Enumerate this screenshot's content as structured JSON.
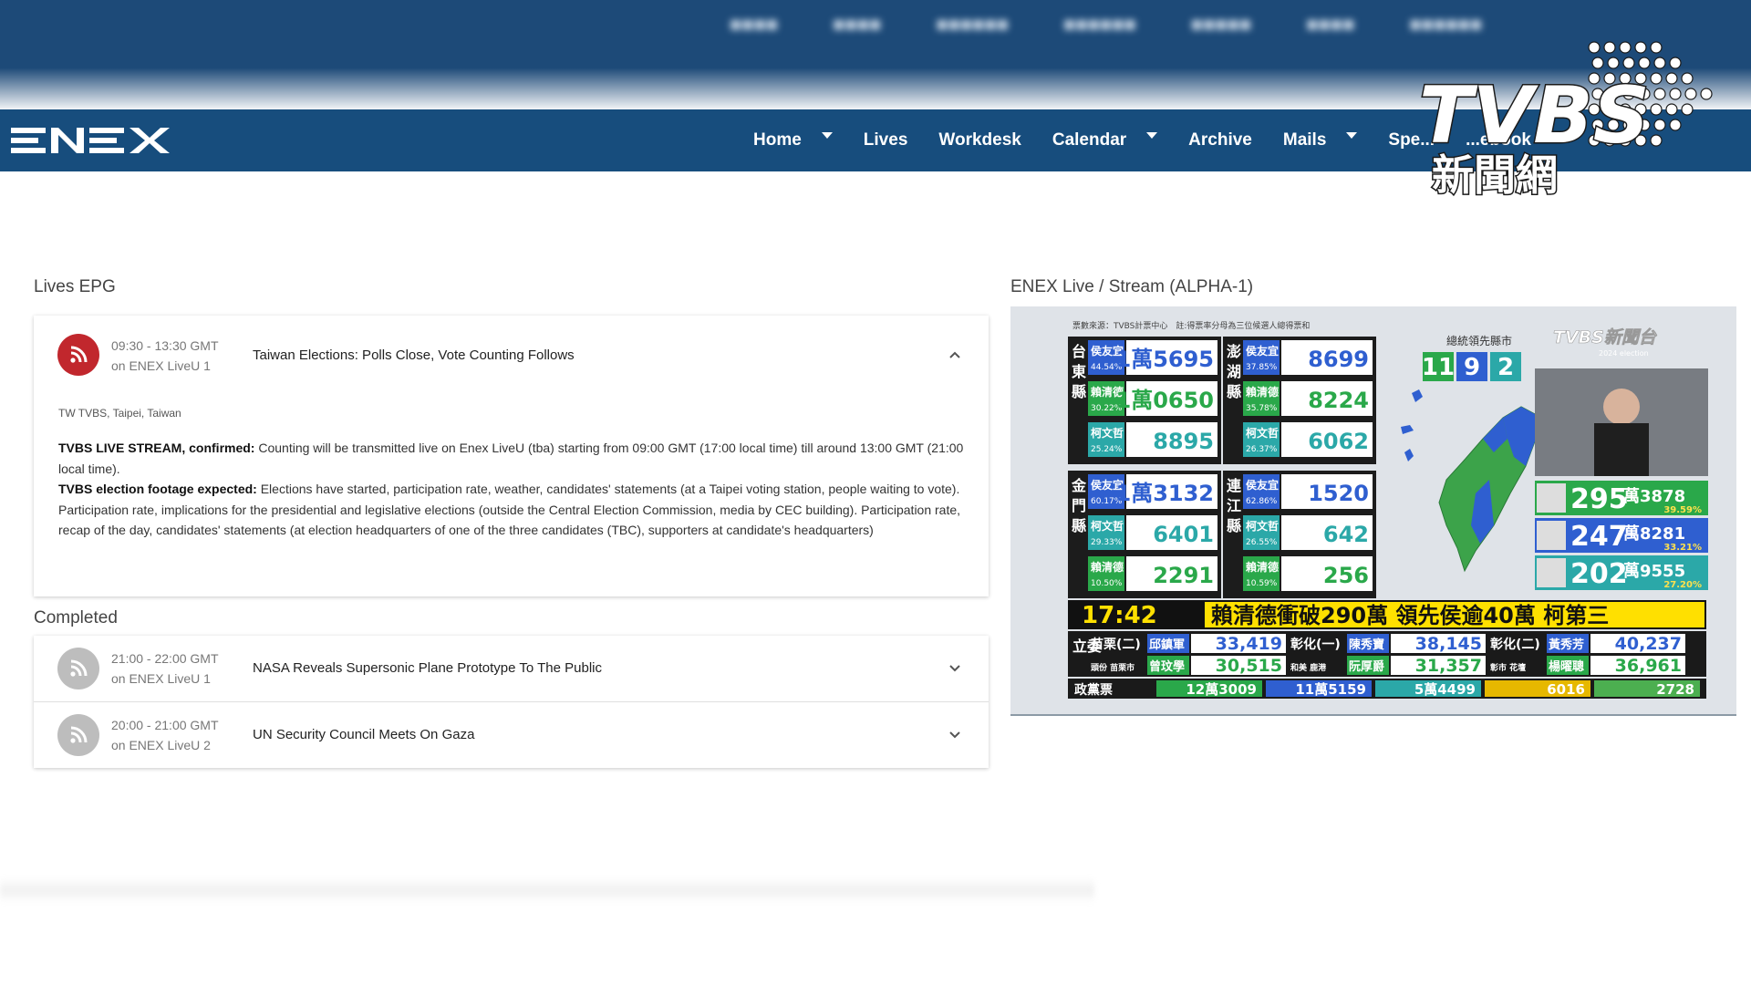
{
  "navbar": {
    "brand": "ENEX",
    "items": [
      {
        "label": "Home",
        "dropdown": true
      },
      {
        "label": "Lives",
        "dropdown": false
      },
      {
        "label": "Workdesk",
        "dropdown": false
      },
      {
        "label": "Calendar",
        "dropdown": true
      },
      {
        "label": "Archive",
        "dropdown": false
      },
      {
        "label": "Mails",
        "dropdown": true
      },
      {
        "label": "Spe...",
        "dropdown": false
      },
      {
        "label": "...ebook",
        "dropdown": false
      }
    ]
  },
  "watermark": {
    "brand": "TVBS",
    "subtitle": "新聞網"
  },
  "lives_epg": {
    "title": "Lives EPG",
    "active": {
      "time": "09:30 - 13:30 GMT",
      "channel": "on ENEX LiveU 1",
      "title": "Taiwan Elections: Polls Close, Vote Counting Follows",
      "location": "TW TVBS, Taipei, Taiwan",
      "para1_bold": "TVBS LIVE STREAM, confirmed:",
      "para1_text": " Counting will be transmitted live on Enex LiveU (tba) starting from 09:00 GMT (17:00 local time) till around 13:00 GMT (21:00 local time).",
      "para2_bold": "TVBS election footage expected:",
      "para2_text": " Elections have started, participation rate, weather, candidates' statements (at a Taipei voting station, people waiting to vote). Participation rate, implications for the presidential and legislative elections (outside the Central Election Commission, media by CEC building). Participation rate, recap of the day, candidates' statements (at election headquarters of one of the three candidates (TBC), supporters at candidate's headquarters)"
    }
  },
  "completed": {
    "title": "Completed",
    "items": [
      {
        "time": "21:00 - 22:00 GMT",
        "channel": "on ENEX LiveU 1",
        "title": "NASA Reveals Supersonic Plane Prototype To The Public"
      },
      {
        "time": "20:00 - 21:00 GMT",
        "channel": "on ENEX LiveU 2",
        "title": "UN Security Council Meets On Gaza"
      }
    ]
  },
  "stream": {
    "title": "ENEX Live / Stream (ALPHA-1)",
    "source_note": "票數來源：TVBS計票中心　註:得票率分母為三位候選人總得票和",
    "channel_logo": "TVBS新聞台",
    "channel_sub": "2024 election",
    "leading_label": "總統領先縣市",
    "leading_counts": [
      "11",
      "9",
      "2"
    ],
    "leading_colors": [
      "#2aa84a",
      "#2f5fd0",
      "#2ba8a8"
    ],
    "counties": [
      {
        "name": "台東縣",
        "rows": [
          {
            "cand": "侯友宜",
            "pct": "44.54%",
            "votes": "1萬5695",
            "color": "#2f5fd0"
          },
          {
            "cand": "賴清德",
            "pct": "30.22%",
            "votes": "1萬0650",
            "color": "#2aa84a"
          },
          {
            "cand": "柯文哲",
            "pct": "25.24%",
            "votes": "8895",
            "color": "#2ba8a8"
          }
        ]
      },
      {
        "name": "澎湖縣",
        "rows": [
          {
            "cand": "侯友宜",
            "pct": "37.85%",
            "votes": "8699",
            "color": "#2f5fd0"
          },
          {
            "cand": "賴清德",
            "pct": "35.78%",
            "votes": "8224",
            "color": "#2aa84a"
          },
          {
            "cand": "柯文哲",
            "pct": "26.37%",
            "votes": "6062",
            "color": "#2ba8a8"
          }
        ]
      },
      {
        "name": "金門縣",
        "rows": [
          {
            "cand": "侯友宜",
            "pct": "60.17%",
            "votes": "1萬3132",
            "color": "#2f5fd0"
          },
          {
            "cand": "柯文哲",
            "pct": "29.33%",
            "votes": "6401",
            "color": "#2ba8a8"
          },
          {
            "cand": "賴清德",
            "pct": "10.50%",
            "votes": "2291",
            "color": "#2aa84a"
          }
        ]
      },
      {
        "name": "連江縣",
        "rows": [
          {
            "cand": "侯友宜",
            "pct": "62.86%",
            "votes": "1520",
            "color": "#2f5fd0"
          },
          {
            "cand": "柯文哲",
            "pct": "26.55%",
            "votes": "642",
            "color": "#2ba8a8"
          },
          {
            "cand": "賴清德",
            "pct": "10.59%",
            "votes": "256",
            "color": "#2aa84a"
          }
        ]
      }
    ],
    "totals": [
      {
        "votes": "295",
        "unit": "萬3878",
        "pct": "39.59%",
        "color": "#2aa84a"
      },
      {
        "votes": "247",
        "unit": "萬8281",
        "pct": "33.21%",
        "color": "#2f5fd0"
      },
      {
        "votes": "202",
        "unit": "萬9555",
        "pct": "27.20%",
        "color": "#2ba8a8"
      }
    ],
    "ticker_time": "17:42",
    "ticker_text": "賴清德衝破290萬 領先侯逾40萬 柯第三",
    "legis_label": "立委",
    "legis": [
      {
        "district": "苗栗(二)",
        "cand1": "邱鎮軍",
        "v1": "33,419",
        "district2": "彰化(一)",
        "cand2": "陳秀寶",
        "v2": "38,145",
        "district3": "彰化(二)",
        "cand3": "黃秀芳",
        "v3": "40,237"
      },
      {
        "district": "頭份 苗栗市",
        "cand1": "曾玟學",
        "v1": "30,515",
        "district2": "和美 鹿港",
        "cand2": "阮厚爵",
        "v2": "31,357",
        "district3": "彰市 花壇",
        "cand3": "楊曜聰",
        "v3": "36,961"
      }
    ],
    "party_label": "政黨票",
    "party": [
      {
        "votes": "12萬3009",
        "color": "#2aa84a"
      },
      {
        "votes": "11萬5159",
        "color": "#2f5fd0"
      },
      {
        "votes": "5萬4499",
        "color": "#2ba8a8"
      },
      {
        "votes": "6016",
        "color": "#e6b800"
      },
      {
        "votes": "2728",
        "color": "#4caf50"
      }
    ]
  }
}
